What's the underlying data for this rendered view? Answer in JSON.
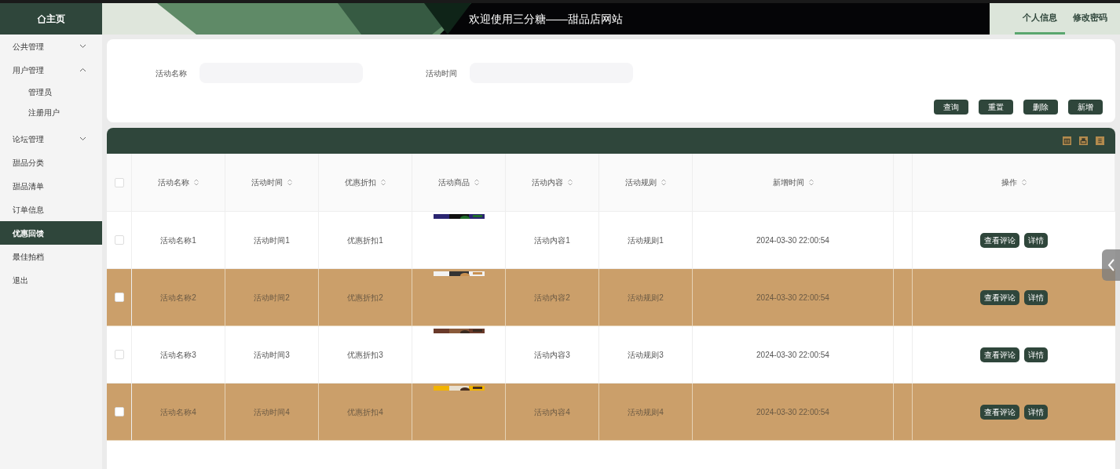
{
  "header": {
    "home_label": "主页",
    "title": "欢迎使用三分糖——甜品店网站",
    "tabs": [
      {
        "label": "个人信息",
        "selected": true
      },
      {
        "label": "修改密码",
        "selected": false
      }
    ]
  },
  "sidebar": {
    "items": [
      {
        "label": "公共管理",
        "expanded": false,
        "selected": false
      },
      {
        "label": "用户管理",
        "expanded": true,
        "selected": false,
        "children": [
          {
            "label": "管理员"
          },
          {
            "label": "注册用户"
          }
        ]
      },
      {
        "label": "论坛管理",
        "expanded": false,
        "selected": false
      },
      {
        "label": "甜品分类",
        "selected": false
      },
      {
        "label": "甜品清单",
        "selected": false
      },
      {
        "label": "订单信息",
        "selected": false
      },
      {
        "label": "优惠回馈",
        "selected": true
      },
      {
        "label": "最佳拍档",
        "selected": false
      },
      {
        "label": "退出",
        "selected": false
      }
    ]
  },
  "search": {
    "fields": [
      {
        "label": "活动名称"
      },
      {
        "label": "活动时间"
      }
    ],
    "buttons": [
      "查询",
      "重置",
      "删除",
      "新增"
    ]
  },
  "table": {
    "all_checked": false,
    "columns": [
      "活动名称",
      "活动时间",
      "优惠折扣",
      "活动商品",
      "活动内容",
      "活动规则",
      "新增时间",
      "操作"
    ],
    "rows": [
      {
        "highlighted": false,
        "checked": false,
        "cells": [
          "活动名称1",
          "活动时间1",
          "优惠折扣1",
          "",
          "活动内容1",
          "活动规则1",
          "2024-03-30 22:00:54"
        ],
        "picture": {
          "kind": "picture"
        },
        "actions": [
          "查看评论",
          "详情"
        ]
      },
      {
        "highlighted": true,
        "checked": false,
        "cells": [
          "活动名称2",
          "活动时间2",
          "优惠折扣2",
          "",
          "活动内容2",
          "活动规则2",
          "2024-03-30 22:00:54"
        ],
        "picture": {
          "kind": "picture"
        },
        "actions": [
          "查看评论",
          "详情"
        ]
      },
      {
        "highlighted": false,
        "checked": false,
        "cells": [
          "活动名称3",
          "活动时间3",
          "优惠折扣3",
          "",
          "活动内容3",
          "活动规则3",
          "2024-03-30 22:00:54"
        ],
        "picture": {
          "kind": "picture"
        },
        "actions": [
          "查看评论",
          "详情"
        ]
      },
      {
        "highlighted": true,
        "checked": false,
        "cells": [
          "活动名称4",
          "活动时间4",
          "优惠折扣4",
          "",
          "活动内容4",
          "活动规则4",
          "2024-03-30 22:00:54"
        ],
        "picture": {
          "kind": "picture"
        },
        "actions": [
          "查看评论",
          "详情"
        ]
      }
    ]
  }
}
